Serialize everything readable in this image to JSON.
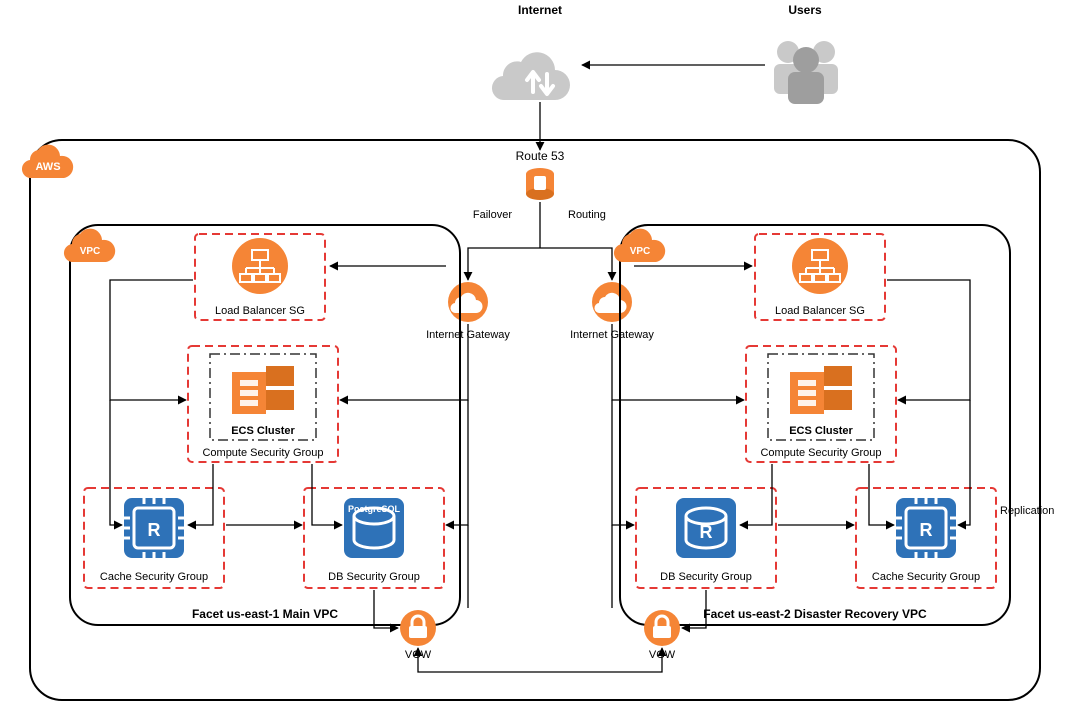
{
  "top": {
    "internet": "Internet",
    "users": "Users"
  },
  "route53": "Route 53",
  "failover": "Failover",
  "routing": "Routing",
  "replication": "Replication",
  "aws_badge": "AWS",
  "vpc_badge": "VPC",
  "igw": "Internet Gateway",
  "vgw": "VGW",
  "left_vpc": {
    "title": "Facet us-east-1 Main VPC",
    "lb_sg": "Load Balancer SG",
    "compute_sg": "Compute Security Group",
    "ecs_inner": "ECS Cluster",
    "cache_sg": "Cache Security Group",
    "db_sg": "DB Security Group",
    "cache_badge": "R",
    "db_badge": "PostgreSQL"
  },
  "right_vpc": {
    "title": "Facet us-east-2 Disaster Recovery VPC",
    "lb_sg": "Load Balancer SG",
    "compute_sg": "Compute Security Group",
    "ecs_inner": "ECS Cluster",
    "cache_sg": "Cache Security Group",
    "db_sg": "DB Security Group",
    "cache_badge": "R",
    "db_badge": "R"
  },
  "colors": {
    "orange": "#f58536",
    "red": "#e53935",
    "blue": "#2e72b8",
    "grey": "#b0b0b0",
    "black": "#000000"
  }
}
